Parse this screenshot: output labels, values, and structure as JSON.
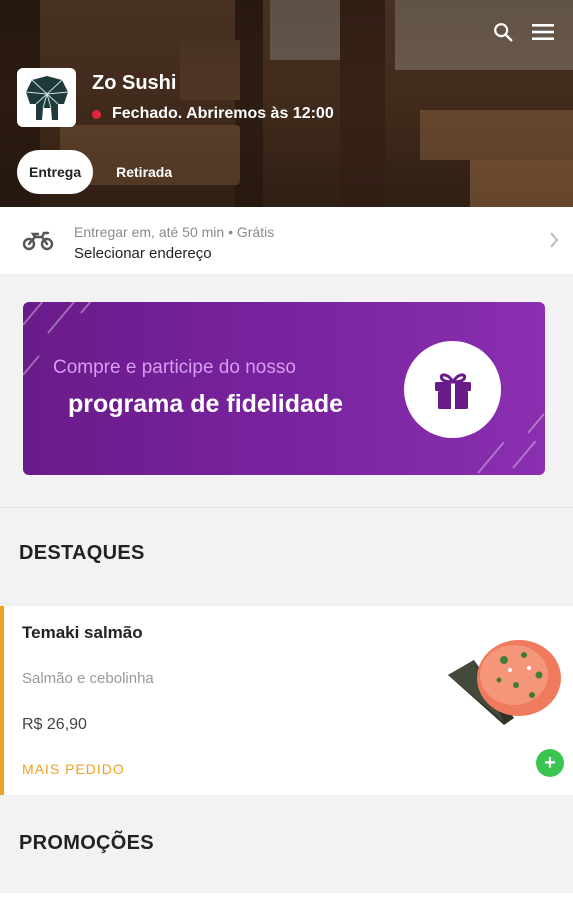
{
  "store": {
    "name": "Zo Sushi",
    "status": "Fechado. Abriremos às 12:00",
    "status_color": "#e5243b"
  },
  "header_icons": [
    "search-icon",
    "menu-icon"
  ],
  "tabs": [
    {
      "label": "Entrega",
      "active": true
    },
    {
      "label": "Retirada",
      "active": false
    }
  ],
  "delivery": {
    "icon": "motorcycle-icon",
    "info": "Entregar em, até 50 min  •  Grátis",
    "action": "Selecionar endereço"
  },
  "banner": {
    "line1": "Compre e participe do nosso",
    "line2": "programa de fidelidade",
    "icon": "gift-icon",
    "color": "#7a24a0"
  },
  "sections": {
    "highlights_title": "DESTAQUES",
    "promotions_title": "PROMOÇÕES"
  },
  "product": {
    "name": "Temaki salmão",
    "description": "Salmão e cebolinha",
    "price": "R$ 26,90",
    "badge": "MAIS PEDIDO",
    "accent_color": "#f0a120",
    "add_button": "+"
  }
}
